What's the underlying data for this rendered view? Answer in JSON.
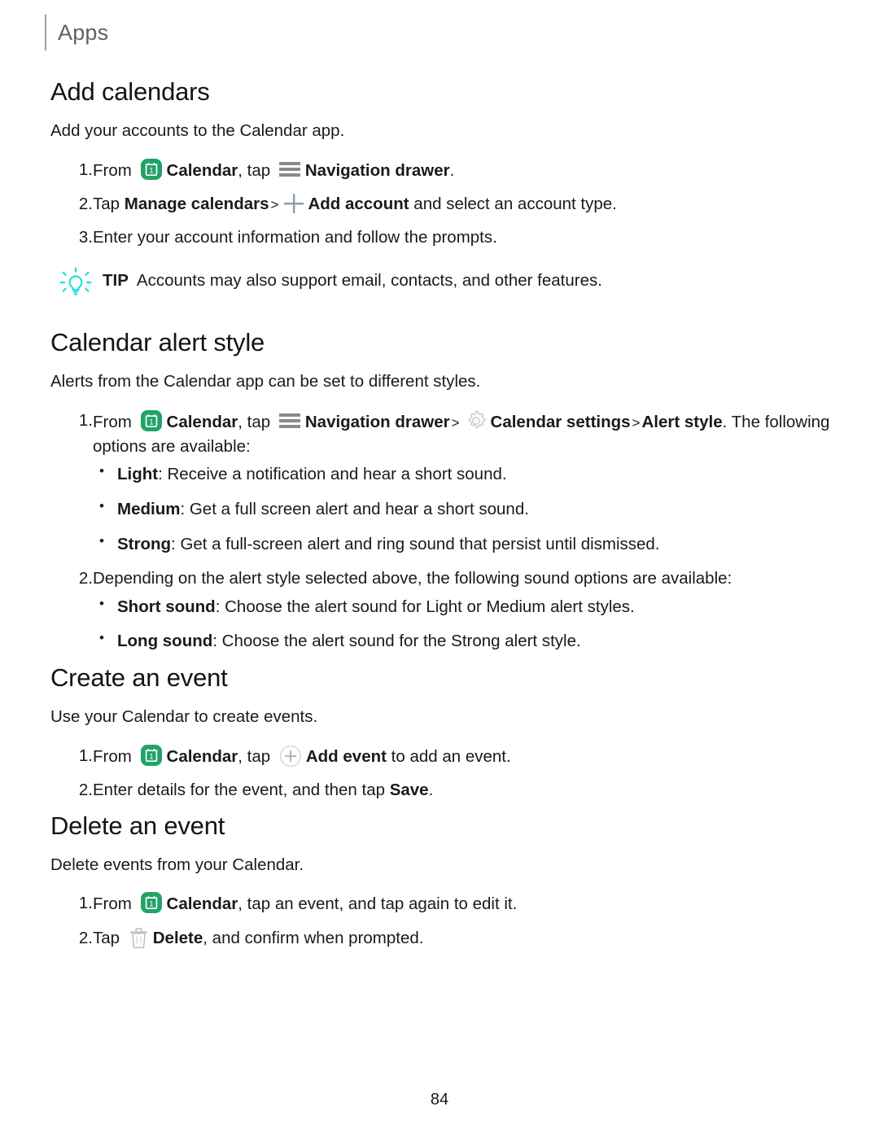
{
  "header": {
    "title": "Apps"
  },
  "sections": [
    {
      "heading": "Add calendars",
      "lead": "Add your accounts to the Calendar app.",
      "steps": [
        {
          "num": "1.",
          "parts": [
            {
              "t": "text",
              "v": "From "
            },
            {
              "t": "icon",
              "v": "calendar-app-icon"
            },
            {
              "t": "bold",
              "v": "Calendar"
            },
            {
              "t": "text",
              "v": ", tap "
            },
            {
              "t": "icon",
              "v": "navigation-drawer-icon"
            },
            {
              "t": "bold",
              "v": "Navigation drawer"
            },
            {
              "t": "text",
              "v": "."
            }
          ]
        },
        {
          "num": "2.",
          "parts": [
            {
              "t": "text",
              "v": "Tap "
            },
            {
              "t": "bold",
              "v": "Manage calendars"
            },
            {
              "t": "chev",
              "v": ">"
            },
            {
              "t": "icon",
              "v": "plus-icon"
            },
            {
              "t": "bold",
              "v": "Add account"
            },
            {
              "t": "text",
              "v": " and select an account type."
            }
          ]
        },
        {
          "num": "3.",
          "parts": [
            {
              "t": "text",
              "v": "Enter your account information and follow the prompts."
            }
          ]
        }
      ],
      "tip": {
        "label": "TIP",
        "text": "Accounts may also support email, contacts, and other features.",
        "icon": "lightbulb-icon",
        "icon_color": "#1ee0e0"
      }
    },
    {
      "heading": "Calendar alert style",
      "lead": "Alerts from the Calendar app can be set to different styles.",
      "steps": [
        {
          "num": "1.",
          "parts": [
            {
              "t": "text",
              "v": "From "
            },
            {
              "t": "icon",
              "v": "calendar-app-icon"
            },
            {
              "t": "bold",
              "v": "Calendar"
            },
            {
              "t": "text",
              "v": ", tap "
            },
            {
              "t": "icon",
              "v": "navigation-drawer-icon"
            },
            {
              "t": "bold",
              "v": "Navigation drawer"
            },
            {
              "t": "chev",
              "v": ">"
            },
            {
              "t": "icon",
              "v": "gear-icon"
            },
            {
              "t": "bold",
              "v": "Calendar settings"
            },
            {
              "t": "chev",
              "v": ">"
            },
            {
              "t": "bold",
              "v": "Alert style"
            },
            {
              "t": "text",
              "v": ". The following options are available:"
            }
          ],
          "bullets": [
            {
              "label": "Light",
              "text": ": Receive a notification and hear a short sound."
            },
            {
              "label": "Medium",
              "text": ": Get a full screen alert and hear a short sound."
            },
            {
              "label": "Strong",
              "text": ": Get a full-screen alert and ring sound that persist until dismissed."
            }
          ]
        },
        {
          "num": "2.",
          "parts": [
            {
              "t": "text",
              "v": "Depending on the alert style selected above, the following sound options are available:"
            }
          ],
          "bullets": [
            {
              "label": "Short sound",
              "text": ": Choose the alert sound for Light or Medium alert styles."
            },
            {
              "label": "Long sound",
              "text": ": Choose the alert sound for the Strong alert style."
            }
          ]
        }
      ]
    },
    {
      "heading": "Create an event",
      "lead": "Use your Calendar to create events.",
      "steps": [
        {
          "num": "1.",
          "parts": [
            {
              "t": "text",
              "v": "From "
            },
            {
              "t": "icon",
              "v": "calendar-app-icon"
            },
            {
              "t": "bold",
              "v": "Calendar"
            },
            {
              "t": "text",
              "v": ", tap "
            },
            {
              "t": "icon",
              "v": "add-event-icon"
            },
            {
              "t": "bold",
              "v": "Add event"
            },
            {
              "t": "text",
              "v": " to add an event."
            }
          ]
        },
        {
          "num": "2.",
          "parts": [
            {
              "t": "text",
              "v": "Enter details for the event, and then tap "
            },
            {
              "t": "bold",
              "v": "Save"
            },
            {
              "t": "text",
              "v": "."
            }
          ]
        }
      ]
    },
    {
      "heading": "Delete an event",
      "lead": "Delete events from your Calendar.",
      "steps": [
        {
          "num": "1.",
          "parts": [
            {
              "t": "text",
              "v": "From "
            },
            {
              "t": "icon",
              "v": "calendar-app-icon"
            },
            {
              "t": "bold",
              "v": "Calendar"
            },
            {
              "t": "text",
              "v": ", tap an event, and tap again to edit it."
            }
          ]
        },
        {
          "num": "2.",
          "parts": [
            {
              "t": "text",
              "v": "Tap "
            },
            {
              "t": "icon",
              "v": "trash-icon"
            },
            {
              "t": "bold",
              "v": "Delete"
            },
            {
              "t": "text",
              "v": ", and confirm when prompted."
            }
          ]
        }
      ]
    }
  ],
  "footer": {
    "page_number": "84"
  },
  "colors": {
    "calendar_icon_green": "#21a366",
    "tip_cyan": "#1ee0e0",
    "icon_gray": "#8f9ba3",
    "header_gray": "#5f6368"
  }
}
